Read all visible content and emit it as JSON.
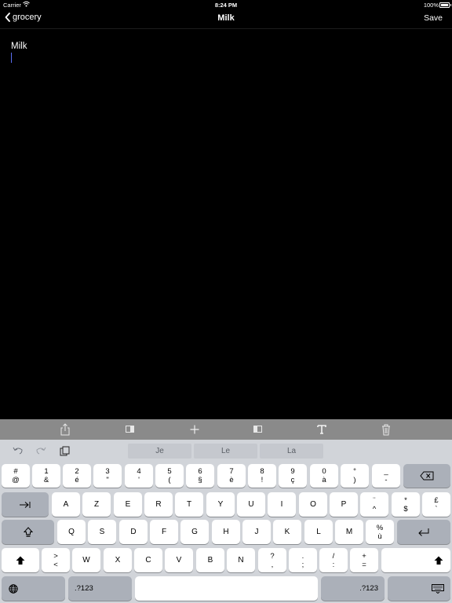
{
  "status_bar": {
    "carrier": "Carrier",
    "time": "8:24 PM",
    "battery": "100%"
  },
  "navbar": {
    "back_label": "grocery",
    "title": "Milk",
    "save_label": "Save"
  },
  "editor": {
    "text": "Milk"
  },
  "toolbar": {
    "icons": [
      "share-icon",
      "previous-note-icon",
      "add-icon",
      "next-note-icon",
      "text-format-icon",
      "trash-icon"
    ]
  },
  "keyboard": {
    "suggestions": [
      "Je",
      "Le",
      "La"
    ],
    "row1": [
      {
        "top": "#",
        "bottom": "@"
      },
      {
        "top": "1",
        "bottom": "&"
      },
      {
        "top": "2",
        "bottom": "é"
      },
      {
        "top": "3",
        "bottom": "\""
      },
      {
        "top": "4",
        "bottom": "'"
      },
      {
        "top": "5",
        "bottom": "("
      },
      {
        "top": "6",
        "bottom": "§"
      },
      {
        "top": "7",
        "bottom": "è"
      },
      {
        "top": "8",
        "bottom": "!"
      },
      {
        "top": "9",
        "bottom": "ç"
      },
      {
        "top": "0",
        "bottom": "à"
      },
      {
        "top": "°",
        "bottom": ")"
      },
      {
        "top": "_",
        "bottom": "-"
      }
    ],
    "row2": [
      "A",
      "Z",
      "E",
      "R",
      "T",
      "Y",
      "U",
      "I",
      "O",
      "P"
    ],
    "row2_extra": [
      {
        "top": "¨",
        "bottom": "^"
      },
      {
        "top": "*",
        "bottom": "$"
      },
      {
        "top": "£",
        "bottom": "`"
      }
    ],
    "row3": [
      "Q",
      "S",
      "D",
      "F",
      "G",
      "H",
      "J",
      "K",
      "L",
      "M"
    ],
    "row3_extra": {
      "top": "%",
      "bottom": "ù"
    },
    "row4": [
      {
        "top": ">",
        "bottom": "<"
      },
      {
        "top": "",
        "bottom": "W"
      },
      {
        "top": "",
        "bottom": "X"
      },
      {
        "top": "",
        "bottom": "C"
      },
      {
        "top": "",
        "bottom": "V"
      },
      {
        "top": "",
        "bottom": "B"
      },
      {
        "top": "",
        "bottom": "N"
      },
      {
        "top": "?",
        "bottom": ","
      },
      {
        "top": ".",
        "bottom": ";"
      },
      {
        "top": "/",
        "bottom": ":"
      },
      {
        "top": "+",
        "bottom": "="
      }
    ],
    "numbers_label": ".?123"
  }
}
